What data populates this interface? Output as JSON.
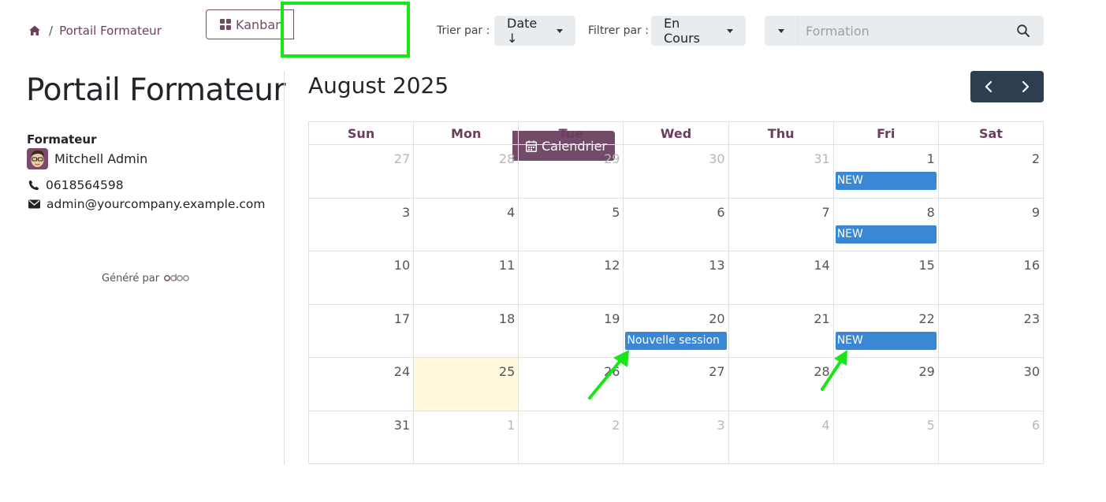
{
  "breadcrumb": {
    "current": "Portail Formateur",
    "separator": "/"
  },
  "views": {
    "kanban": "Kanban",
    "calendar": "Calendrier"
  },
  "sort": {
    "label": "Trier par :",
    "value": "Date ↓"
  },
  "filter": {
    "label": "Filtrer par :",
    "value": "En Cours"
  },
  "search": {
    "placeholder": "Formation"
  },
  "left_panel": {
    "title": "Portail Formateur",
    "role_label": "Formateur",
    "trainer_name": "Mitchell Admin",
    "phone": "0618564598",
    "email": "admin@yourcompany.example.com",
    "generated_by": "Généré par",
    "brand": "odoo"
  },
  "calendar": {
    "month": "August 2025",
    "weekdays": [
      "Sun",
      "Mon",
      "Tue",
      "Wed",
      "Thu",
      "Fri",
      "Sat"
    ],
    "weeks": [
      [
        {
          "day": "27",
          "other": true
        },
        {
          "day": "28",
          "other": true
        },
        {
          "day": "29",
          "other": true
        },
        {
          "day": "30",
          "other": true
        },
        {
          "day": "31",
          "other": true
        },
        {
          "day": "1",
          "event": "NEW"
        },
        {
          "day": "2"
        }
      ],
      [
        {
          "day": "3"
        },
        {
          "day": "4"
        },
        {
          "day": "5"
        },
        {
          "day": "6"
        },
        {
          "day": "7"
        },
        {
          "day": "8",
          "event": "NEW"
        },
        {
          "day": "9"
        }
      ],
      [
        {
          "day": "10"
        },
        {
          "day": "11"
        },
        {
          "day": "12"
        },
        {
          "day": "13"
        },
        {
          "day": "14"
        },
        {
          "day": "15"
        },
        {
          "day": "16"
        }
      ],
      [
        {
          "day": "17"
        },
        {
          "day": "18"
        },
        {
          "day": "19"
        },
        {
          "day": "20",
          "event": "Nouvelle session"
        },
        {
          "day": "21"
        },
        {
          "day": "22",
          "event": "NEW"
        },
        {
          "day": "23"
        }
      ],
      [
        {
          "day": "24"
        },
        {
          "day": "25",
          "today": true
        },
        {
          "day": "26"
        },
        {
          "day": "27"
        },
        {
          "day": "28"
        },
        {
          "day": "29"
        },
        {
          "day": "30"
        }
      ],
      [
        {
          "day": "31"
        },
        {
          "day": "1",
          "other": true
        },
        {
          "day": "2",
          "other": true
        },
        {
          "day": "3",
          "other": true
        },
        {
          "day": "4",
          "other": true
        },
        {
          "day": "5",
          "other": true
        },
        {
          "day": "6",
          "other": true
        }
      ]
    ]
  },
  "colors": {
    "brand": "#714b67",
    "event": "#3a87d6",
    "today": "#fff8dc",
    "nav": "#2c3e50",
    "annotation": "#19e619"
  }
}
